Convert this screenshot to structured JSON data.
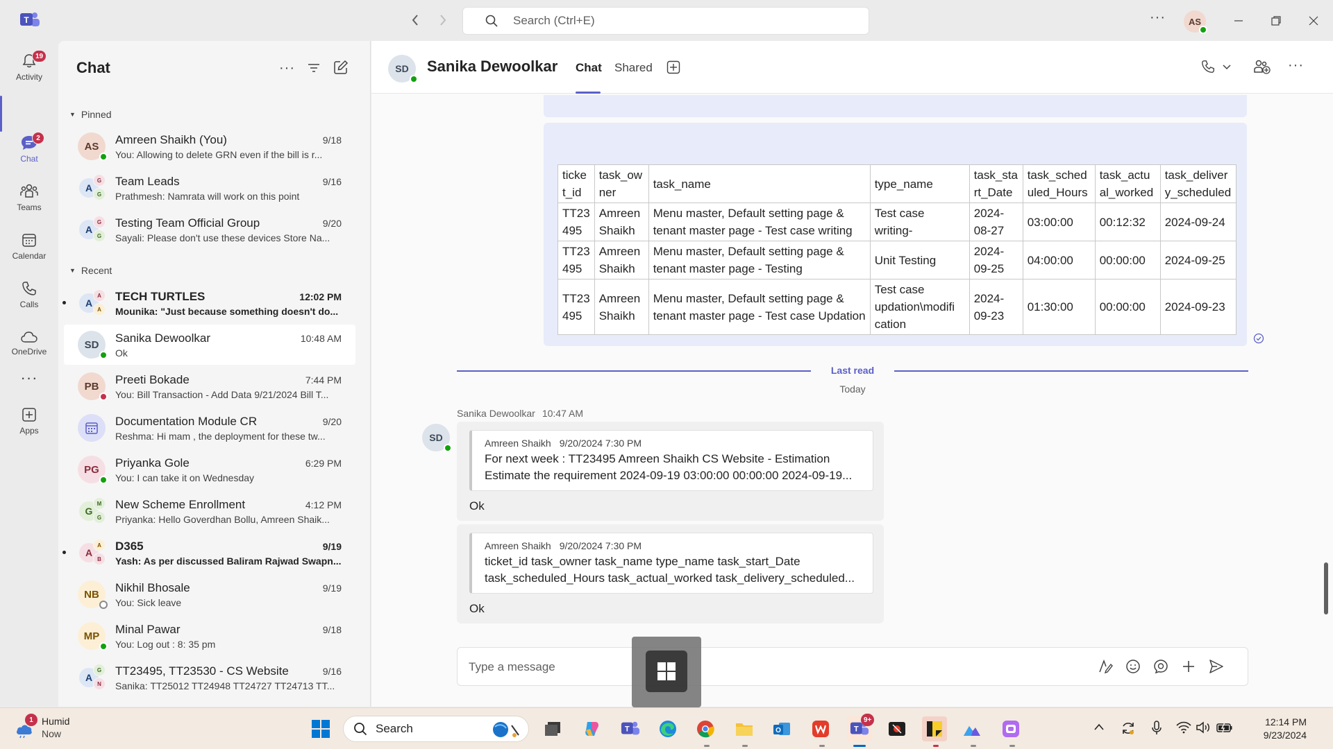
{
  "titlebar": {
    "search_placeholder": "Search (Ctrl+E)",
    "user_initials": "AS"
  },
  "rail": [
    {
      "label": "Activity",
      "badge": "19"
    },
    {
      "label": "Chat",
      "badge": "2"
    },
    {
      "label": "Teams",
      "badge": ""
    },
    {
      "label": "Calendar",
      "badge": ""
    },
    {
      "label": "Calls",
      "badge": ""
    },
    {
      "label": "OneDrive",
      "badge": ""
    },
    {
      "label": "Apps",
      "badge": ""
    }
  ],
  "chatlist": {
    "title": "Chat",
    "pinned_label": "Pinned",
    "recent_label": "Recent",
    "pinned": [
      {
        "initials": "AS",
        "name": "Amreen Shaikh (You)",
        "time": "9/18",
        "preview": "You: Allowing to delete GRN even if the bill is r...",
        "group": false,
        "g1": "",
        "g2": "",
        "g3": ""
      },
      {
        "initials": "",
        "name": "Team Leads",
        "time": "9/16",
        "preview": "Prathmesh: Namrata will work on this point",
        "group": true,
        "g1": "A",
        "g2": "G",
        "g3": "G"
      },
      {
        "initials": "",
        "name": "Testing Team Official Group",
        "time": "9/20",
        "preview": "Sayali: Please don't use these devices Store Na...",
        "group": true,
        "g1": "A",
        "g2": "G",
        "g3": "G"
      }
    ],
    "recent": [
      {
        "initials": "",
        "name": "TECH TURTLES",
        "time": "12:02 PM",
        "preview": "Mounika: \"Just because something doesn't do...",
        "group": true,
        "g1": "A",
        "g2": "A",
        "g3": "A"
      },
      {
        "initials": "SD",
        "name": "Sanika Dewoolkar",
        "time": "10:48 AM",
        "preview": "Ok",
        "group": false
      },
      {
        "initials": "PB",
        "name": "Preeti Bokade",
        "time": "7:44 PM",
        "preview": "You: Bill Transaction - Add Data 9/21/2024 Bill T...",
        "group": false
      },
      {
        "initials": "",
        "name": "Documentation Module CR",
        "time": "9/20",
        "preview": "Reshma: Hi mam , the deployment for these tw...",
        "group": false
      },
      {
        "initials": "PG",
        "name": "Priyanka Gole",
        "time": "6:29 PM",
        "preview": "You: I can take it on Wednesday",
        "group": false
      },
      {
        "initials": "",
        "name": "New Scheme Enrollment",
        "time": "4:12 PM",
        "preview": "Priyanka: Hello Goverdhan Bollu, Amreen Shaik...",
        "group": true,
        "g1": "G",
        "g2": "M",
        "g3": "G"
      },
      {
        "initials": "",
        "name": "D365",
        "time": "9/19",
        "preview": "Yash: As per discussed Baliram Rajwad Swapn...",
        "group": true,
        "g1": "A",
        "g2": "A",
        "g3": "B"
      },
      {
        "initials": "NB",
        "name": "Nikhil Bhosale",
        "time": "9/19",
        "preview": "You: Sick leave",
        "group": false
      },
      {
        "initials": "MP",
        "name": "Minal Pawar",
        "time": "9/18",
        "preview": "You: Log out : 8: 35 pm",
        "group": false
      },
      {
        "initials": "",
        "name": "TT23495, TT23530 - CS Website",
        "time": "9/16",
        "preview": "Sanika: TT25012 TT24948 TT24727 TT24713 TT...",
        "group": true,
        "g1": "A",
        "g2": "G",
        "g3": "N"
      }
    ]
  },
  "conversation": {
    "initials": "SD",
    "name": "Sanika Dewoolkar",
    "tabs": [
      "Chat",
      "Shared"
    ],
    "table": {
      "headers": [
        "ticke t_id",
        "task_ow ner",
        "task_name",
        "type_name",
        "task_sta rt_Date",
        "task_sched uled_Hours",
        "task_actu al_worked",
        "task_deliver y_scheduled"
      ],
      "rows": [
        [
          "TT23 495",
          "Amreen Shaikh",
          "Menu master, Default setting page & tenant master page - Test case writing",
          "Test case writing-",
          "2024- 08-27",
          "03:00:00",
          "00:12:32",
          "2024-09-24"
        ],
        [
          "TT23 495",
          "Amreen Shaikh",
          "Menu master, Default setting page & tenant master page - Testing",
          "Unit Testing",
          "2024- 09-25",
          "04:00:00",
          "00:00:00",
          "2024-09-25"
        ],
        [
          "TT23 495",
          "Amreen Shaikh",
          "Menu master, Default setting page & tenant master page - Test case Updation",
          "Test case updation\\modifi cation",
          "2024- 09-23",
          "01:30:00",
          "00:00:00",
          "2024-09-23"
        ]
      ]
    },
    "last_read": "Last read",
    "day": "Today",
    "sender": "Sanika Dewoolkar",
    "sent_time": "10:47 AM",
    "messages": [
      {
        "quote_author": "Amreen Shaikh",
        "quote_time": "9/20/2024 7:30 PM",
        "quote_line1": "For next week : TT23495 Amreen Shaikh CS Website - Estimation",
        "quote_line2": "Estimate the requirement 2024-09-19 03:00:00 00:00:00 2024-09-19...",
        "text": "Ok"
      },
      {
        "quote_author": "Amreen Shaikh",
        "quote_time": "9/20/2024 7:30 PM",
        "quote_line1": "ticket_id task_owner task_name type_name task_start_Date",
        "quote_line2": "task_scheduled_Hours task_actual_worked task_delivery_scheduled...",
        "text": "Ok"
      }
    ],
    "compose_placeholder": "Type a message"
  },
  "taskbar": {
    "weather_title": "Humid",
    "weather_sub": "Now",
    "weather_badge": "1",
    "search_label": "Search",
    "teams_badge": "9+",
    "time": "12:14 PM",
    "date": "9/23/2024"
  }
}
